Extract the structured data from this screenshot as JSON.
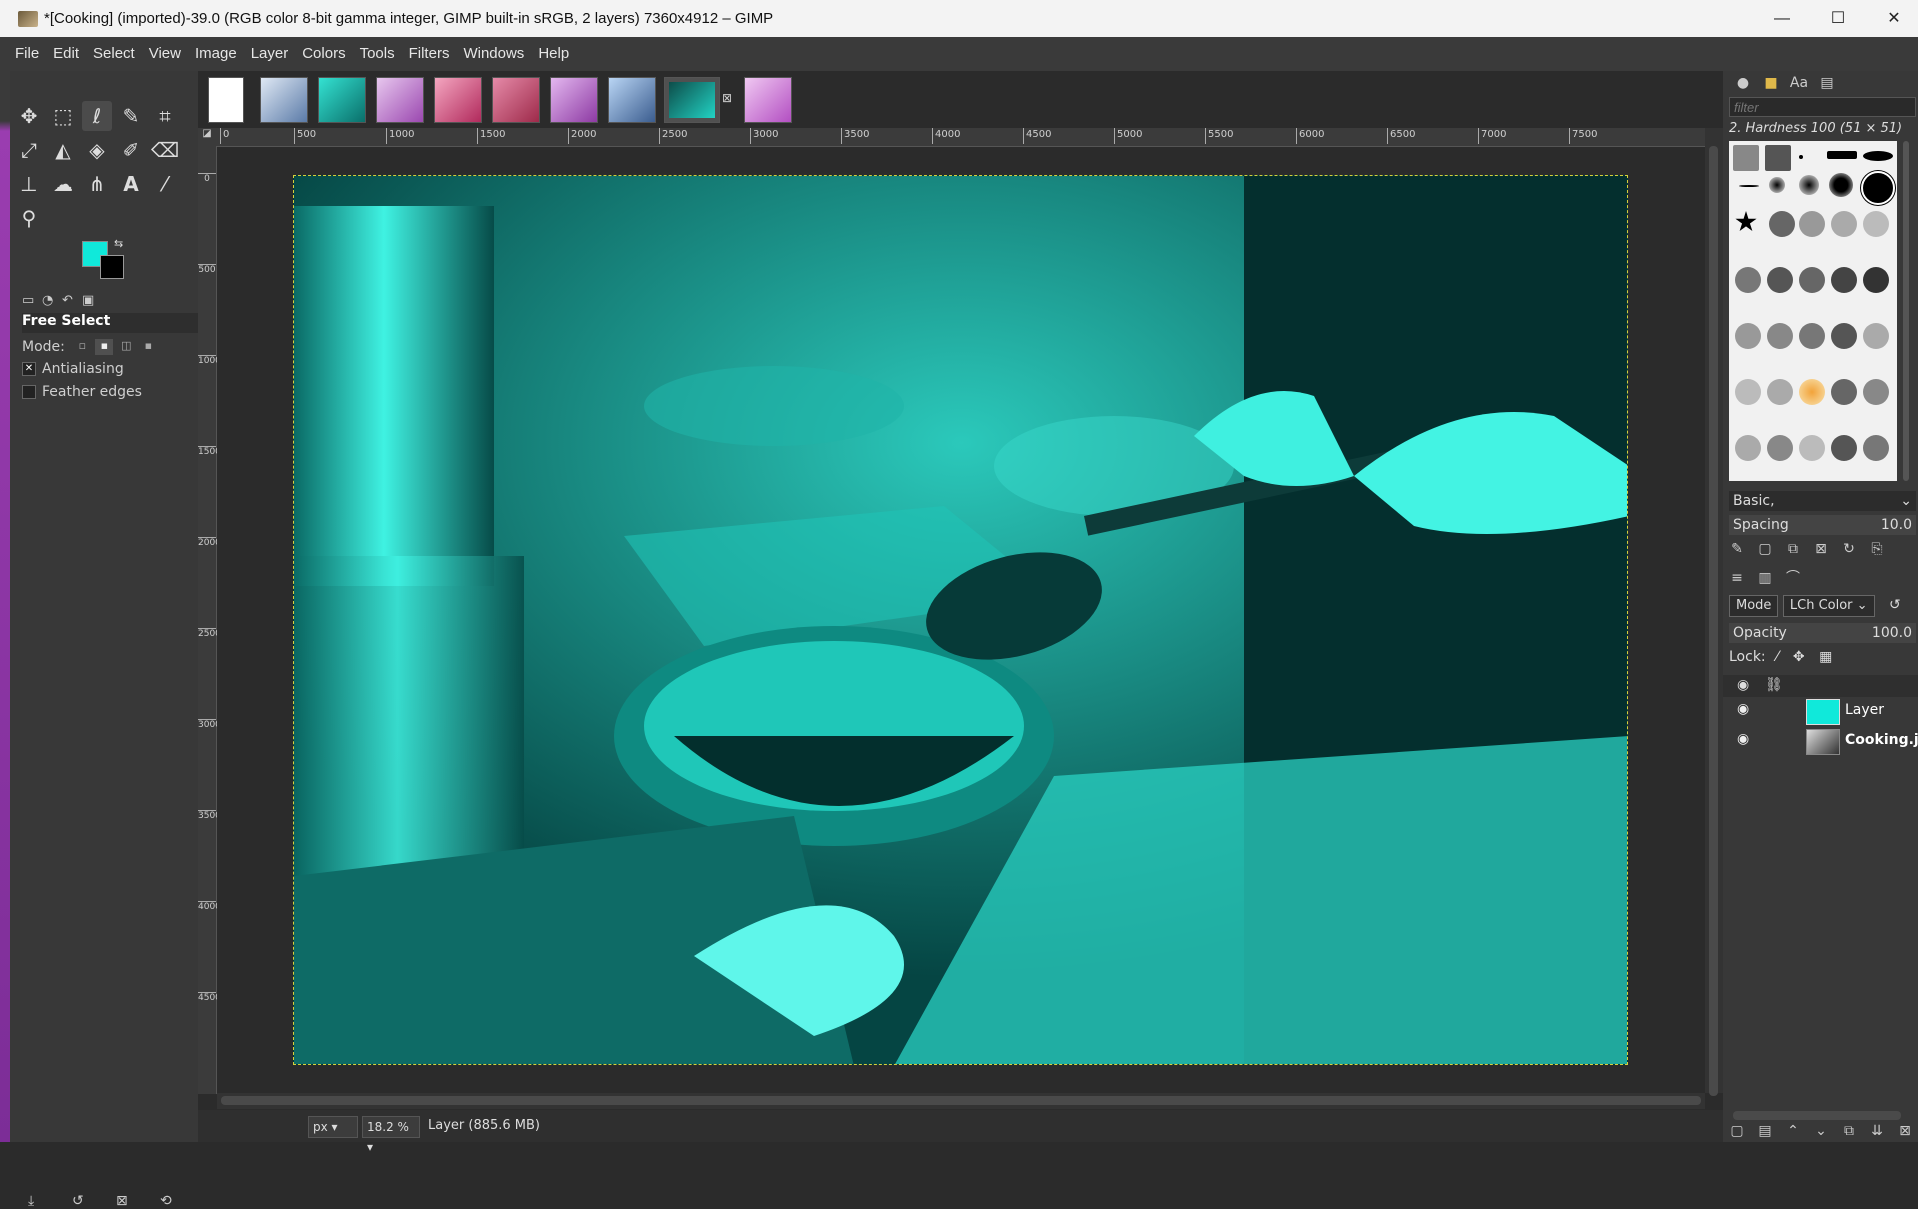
{
  "window": {
    "title": "*[Cooking] (imported)-39.0 (RGB color 8-bit gamma integer, GIMP built-in sRGB, 2 layers) 7360x4912 – GIMP",
    "minimize": "—",
    "maximize": "☐",
    "close": "✕"
  },
  "menu": [
    "File",
    "Edit",
    "Select",
    "View",
    "Image",
    "Layer",
    "Colors",
    "Tools",
    "Filters",
    "Windows",
    "Help"
  ],
  "colors": {
    "foreground": "#10e9da",
    "background": "#000000",
    "accent": "#1be7d6"
  },
  "tool_options": {
    "title": "Free Select",
    "mode_label": "Mode:",
    "antialiasing_label": "Antialiasing",
    "antialiasing_checked": true,
    "feather_label": "Feather edges",
    "feather_checked": false
  },
  "ruler": {
    "h_labels": [
      "0",
      "500",
      "1000",
      "1500",
      "2000",
      "2500",
      "3000",
      "3500",
      "4000",
      "4500",
      "5000",
      "5500",
      "6000",
      "6500",
      "7000",
      "7500"
    ]
  },
  "status": {
    "unit": "px",
    "zoom": "18.2 %",
    "info": "Layer (885.6 MB)"
  },
  "brushes": {
    "filter_placeholder": "filter",
    "selected_brush": "2. Hardness 100 (51 × 51)",
    "preset": "Basic,",
    "spacing_label": "Spacing",
    "spacing_value": "10.0"
  },
  "layers": {
    "mode_label": "Mode",
    "mode_value": "LCh Color",
    "opacity_label": "Opacity",
    "opacity_value": "100.0",
    "lock_label": "Lock:",
    "items": [
      {
        "name": "Layer",
        "visible": true
      },
      {
        "name": "Cooking.jp",
        "visible": true
      }
    ]
  }
}
